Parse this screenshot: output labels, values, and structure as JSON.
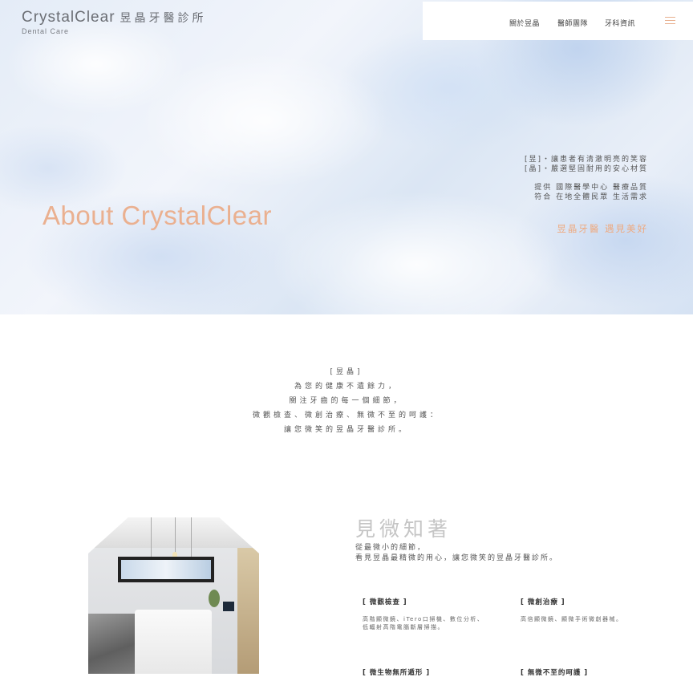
{
  "brand": {
    "name": "CrystalClear",
    "name_cn": "昱晶牙醫診所",
    "sub": "Dental Care"
  },
  "nav": {
    "items": [
      "關於昱晶",
      "醫師團隊",
      "牙科資訊"
    ],
    "menu_icon": "hamburger-menu-icon",
    "accent_color": "#e8b08f"
  },
  "hero": {
    "title": "About CrystalClear",
    "lines": [
      "[昱]・讓患者有清澈明亮的笑容",
      "[晶]・嚴選堅固耐用的安心材質",
      "提供 國際醫學中心 醫療品質",
      "符合 在地全體民眾 生活需求"
    ],
    "slogan": "昱晶牙醫 遇見美好",
    "title_color": "#eab090"
  },
  "intro": {
    "lines": [
      "[昱晶]",
      "為您的健康不遺餘力，",
      "關注牙齒的每一個細節，",
      "微觀檢查、微創治療、無微不至的呵護：",
      "讓您微笑的昱晶牙醫診所。"
    ]
  },
  "feature": {
    "title": "見微知著",
    "desc": [
      "從最微小的細節，",
      "看見昱晶最精微的用心，讓您微笑的昱晶牙醫診所。"
    ],
    "cards": [
      {
        "title": "[ 微觀檢查 ]",
        "text": [
          "高階顯微鏡、iTero口掃機、數位分析、",
          "低輻射高階電腦斷層掃描。"
        ]
      },
      {
        "title": "[ 微創治療 ]",
        "text": [
          "高倍顯微鏡、顯微手術微創器械。"
        ]
      },
      {
        "title": "[ 微生物無所遁形 ]",
        "text": []
      },
      {
        "title": "[ 無微不至的呵護 ]",
        "text": []
      }
    ]
  }
}
